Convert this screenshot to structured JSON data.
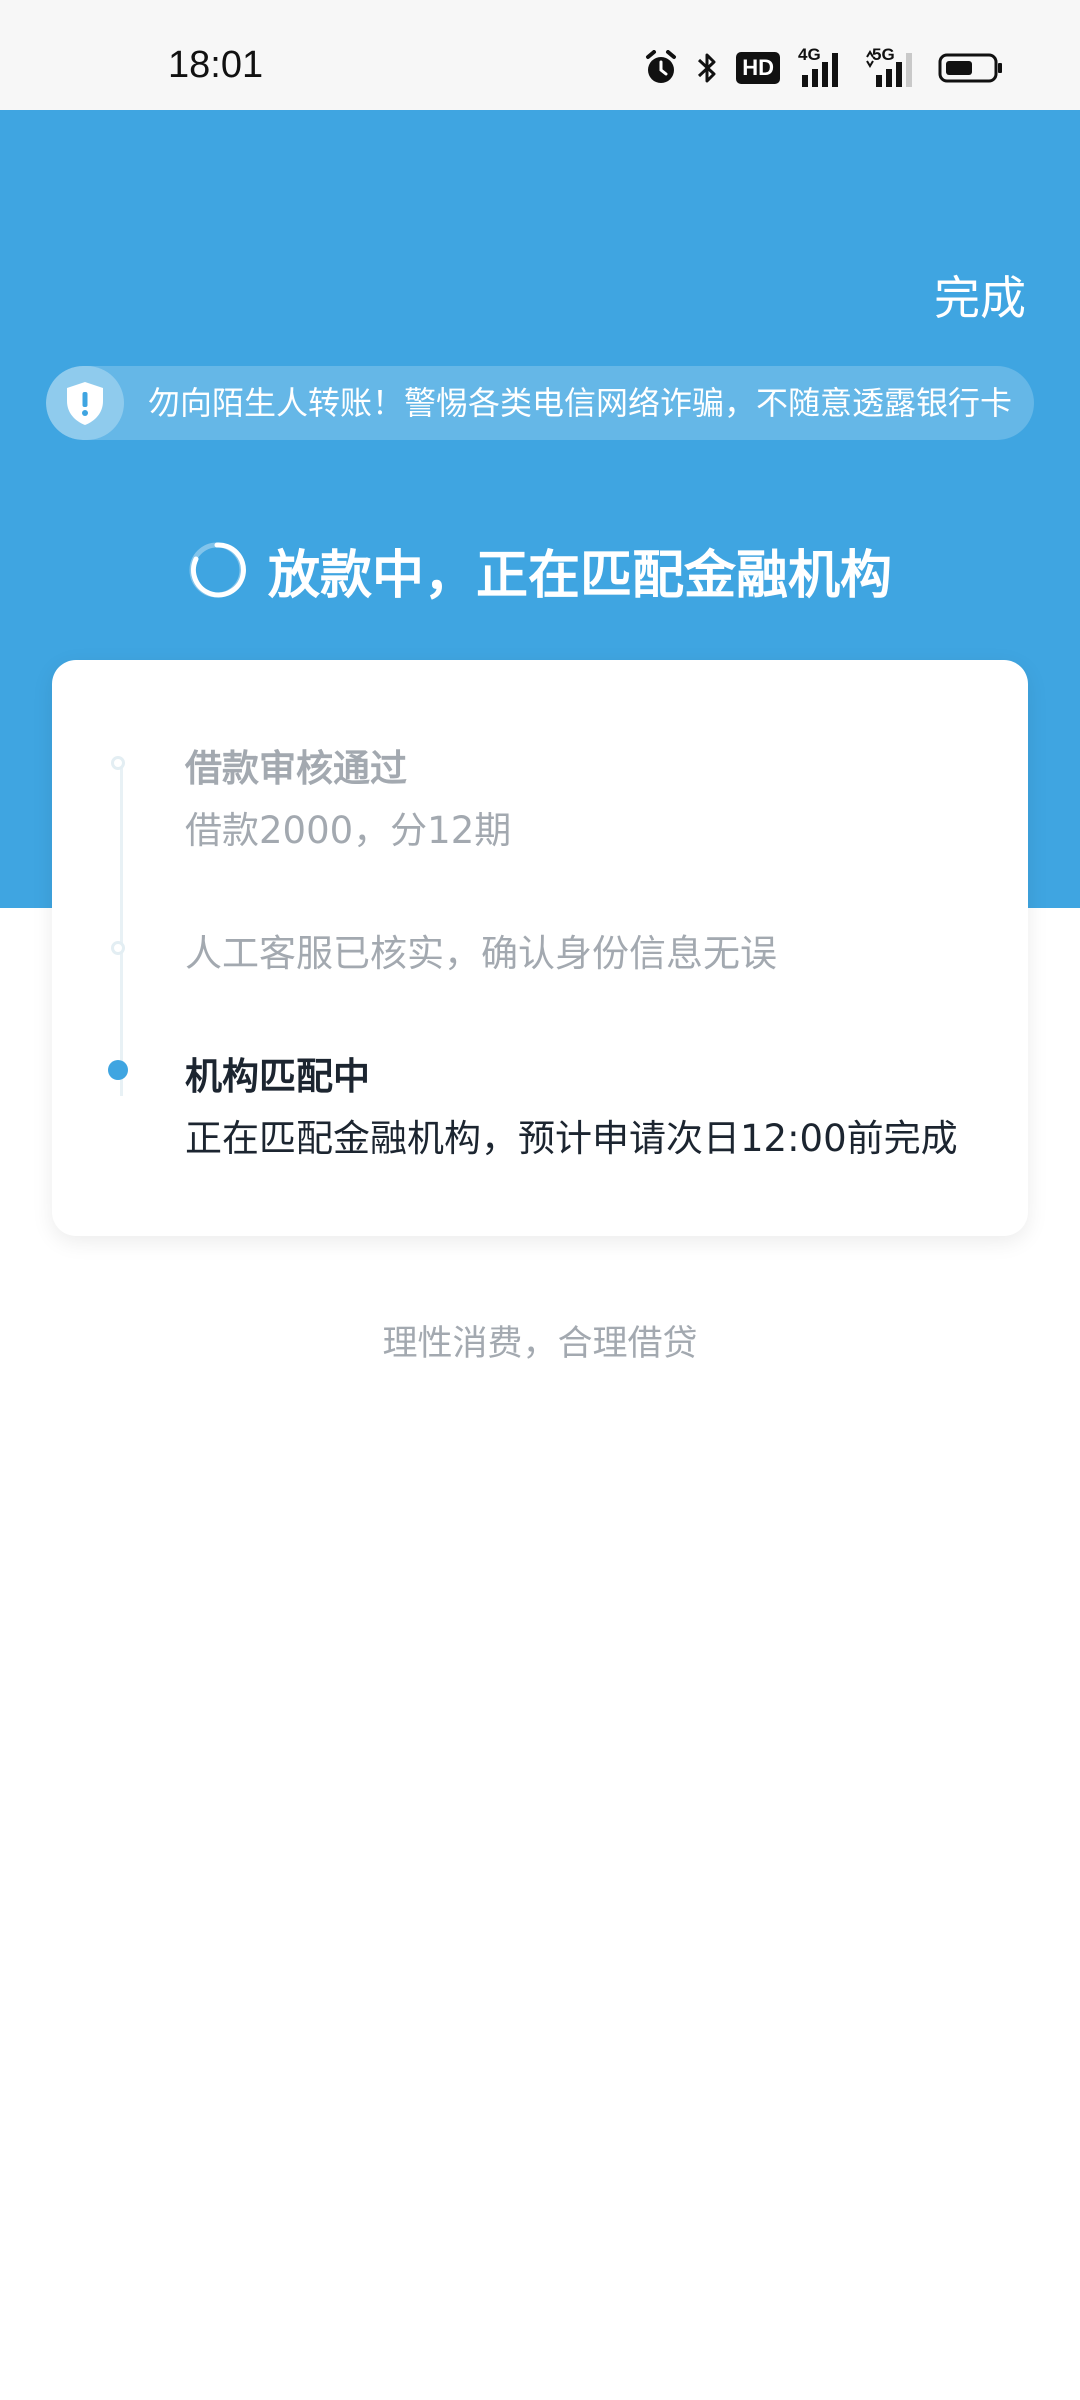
{
  "status_bar": {
    "time": "18:01",
    "icons": [
      "alarm-icon",
      "bluetooth-icon",
      "hd-icon",
      "4g-signal-icon",
      "5g-signal-icon",
      "battery-icon"
    ],
    "hd_label": "HD",
    "net_4g": "4G",
    "net_5g": "5G"
  },
  "header": {
    "done_label": "完成",
    "notice_text": "勿向陌生人转账！警惕各类电信网络诈骗，不随意透露银行卡",
    "status_title": "放款中，正在匹配金融机构"
  },
  "steps": [
    {
      "title": "借款审核通过",
      "subtitle": "借款2000，分12期",
      "state": "done"
    },
    {
      "title": "人工客服已核实，确认身份信息无误",
      "state": "done"
    },
    {
      "title": "机构匹配中",
      "subtitle": "正在匹配金融机构，预计申请次日12:00前完成",
      "state": "active"
    }
  ],
  "footer_note": "理性消费，合理借贷",
  "colors": {
    "brand_blue": "#3fa5e1",
    "muted_text": "#a3a9b0",
    "dark_text": "#1c2530"
  }
}
